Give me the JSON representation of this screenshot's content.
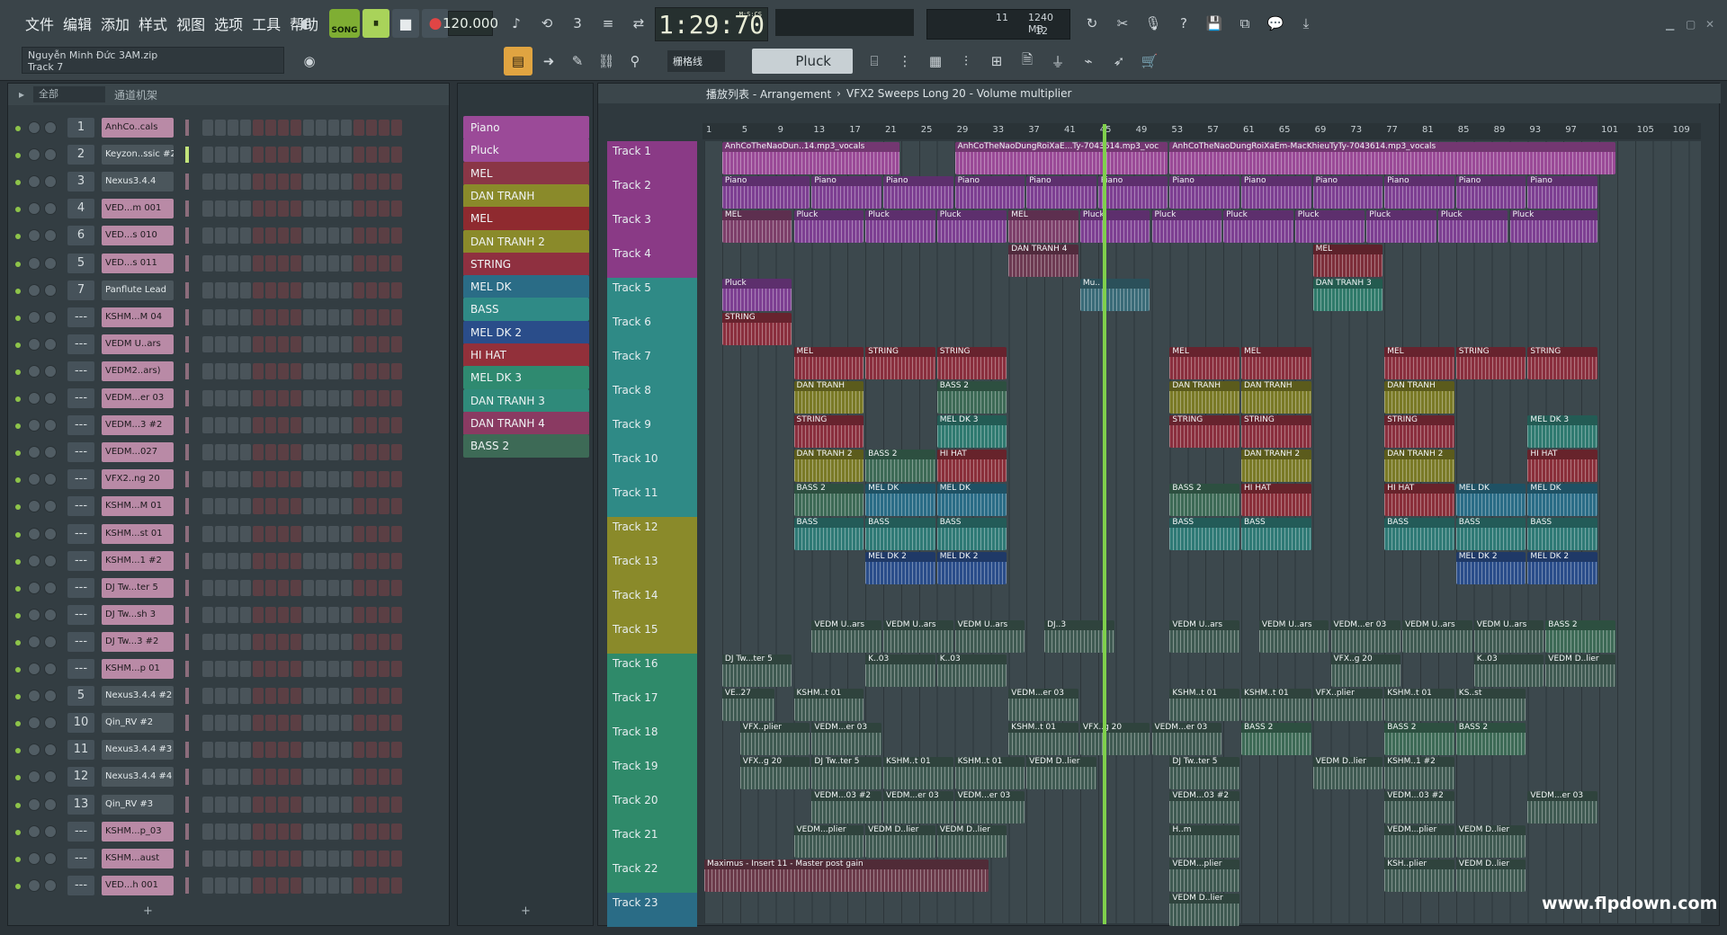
{
  "menu": [
    "文件",
    "编辑",
    "添加",
    "样式",
    "视图",
    "选项",
    "工具",
    "帮助"
  ],
  "transport": {
    "song_label": "SONG",
    "play": "⏸",
    "stop": "■",
    "record": "●",
    "tempo": "120.000",
    "time": "1:29:70",
    "time_unit": "M:S:CS"
  },
  "cpu": {
    "v1": "11",
    "v2": "1240 MB",
    "v3": "12"
  },
  "project": {
    "file": "Nguyễn Minh Đức 3AM.zip",
    "track": "Track 7"
  },
  "toolbar": {
    "snap": "栅格线",
    "pattern": "Pluck"
  },
  "rack": {
    "title": "通道机架",
    "filter": "全部"
  },
  "channels": [
    {
      "num": "1",
      "name": "AnhCo..cals",
      "sel": true
    },
    {
      "num": "2",
      "name": "Keyzon..ssic #2",
      "sel": false
    },
    {
      "num": "3",
      "name": "Nexus3.4.4",
      "sel": false
    },
    {
      "num": "4",
      "name": "VED...m 001",
      "sel": true
    },
    {
      "num": "6",
      "name": "VED...s 010",
      "sel": true
    },
    {
      "num": "5",
      "name": "VED...s 011",
      "sel": true
    },
    {
      "num": "7",
      "name": "Panflute Lead",
      "sel": false
    },
    {
      "num": "---",
      "name": "KSHM...M 04",
      "sel": true
    },
    {
      "num": "---",
      "name": "VEDM U..ars",
      "sel": true
    },
    {
      "num": "---",
      "name": "VEDM2..ars)",
      "sel": true
    },
    {
      "num": "---",
      "name": "VEDM...er 03",
      "sel": true
    },
    {
      "num": "---",
      "name": "VEDM...3 #2",
      "sel": true
    },
    {
      "num": "---",
      "name": "VEDM...027",
      "sel": true
    },
    {
      "num": "---",
      "name": "VFX2..ng 20",
      "sel": true
    },
    {
      "num": "---",
      "name": "KSHM...M 01",
      "sel": true
    },
    {
      "num": "---",
      "name": "KSHM...st 01",
      "sel": true
    },
    {
      "num": "---",
      "name": "KSHM...1 #2",
      "sel": true
    },
    {
      "num": "---",
      "name": "DJ Tw...ter 5",
      "sel": true
    },
    {
      "num": "---",
      "name": "DJ Tw...sh 3",
      "sel": true
    },
    {
      "num": "---",
      "name": "DJ Tw...3 #2",
      "sel": true
    },
    {
      "num": "---",
      "name": "KSHM...p 01",
      "sel": true
    },
    {
      "num": "5",
      "name": "Nexus3.4.4 #2",
      "sel": false
    },
    {
      "num": "10",
      "name": "Qin_RV #2",
      "sel": false
    },
    {
      "num": "11",
      "name": "Nexus3.4.4 #3",
      "sel": false
    },
    {
      "num": "12",
      "name": "Nexus3.4.4 #4",
      "sel": false
    },
    {
      "num": "13",
      "name": "Qin_RV #3",
      "sel": false
    },
    {
      "num": "---",
      "name": "KSHM...p_03",
      "sel": true
    },
    {
      "num": "---",
      "name": "KSHM...aust",
      "sel": true
    },
    {
      "num": "---",
      "name": "VED...h 001",
      "sel": true
    }
  ],
  "patterns": [
    {
      "name": "Piano",
      "color": "#9b4a98"
    },
    {
      "name": "Pluck",
      "color": "#9b4a98"
    },
    {
      "name": "MEL",
      "color": "#8a3646"
    },
    {
      "name": "DAN TRANH",
      "color": "#8a8a2a"
    },
    {
      "name": "MEL",
      "color": "#8f2a2f"
    },
    {
      "name": "DAN TRANH 2",
      "color": "#8a8a2a"
    },
    {
      "name": "STRING",
      "color": "#8f3040"
    },
    {
      "name": "MEL DK",
      "color": "#2a6c86"
    },
    {
      "name": "BASS",
      "color": "#2f8a86"
    },
    {
      "name": "MEL DK 2",
      "color": "#2a4d8a"
    },
    {
      "name": "HI HAT",
      "color": "#92303a"
    },
    {
      "name": "MEL DK 3",
      "color": "#2f8a70"
    },
    {
      "name": "DAN TRANH 3",
      "color": "#2f8a7a"
    },
    {
      "name": "DAN TRANH 4",
      "color": "#8a3a62"
    },
    {
      "name": "BASS 2",
      "color": "#3d6a56"
    }
  ],
  "playlist": {
    "title": "播放列表 - Arrangement",
    "arrow": "›",
    "pattern": "VFX2 Sweeps Long 20 - Volume multiplier"
  },
  "ruler": [
    "1",
    "5",
    "9",
    "13",
    "17",
    "21",
    "25",
    "29",
    "33",
    "37",
    "41",
    "45",
    "49",
    "53",
    "57",
    "61",
    "65",
    "69",
    "73",
    "77",
    "81",
    "85",
    "89",
    "93",
    "97",
    "101",
    "105",
    "109"
  ],
  "tracks": [
    "Track 1",
    "Track 2",
    "Track 3",
    "Track 4",
    "Track 5",
    "Track 6",
    "Track 7",
    "Track 8",
    "Track 9",
    "Track 10",
    "Track 11",
    "Track 12",
    "Track 13",
    "Track 14",
    "Track 15",
    "Track 16",
    "Track 17",
    "Track 18",
    "Track 19",
    "Track 20",
    "Track 21",
    "Track 22",
    "Track 23"
  ],
  "track_colors": [
    "#8a3a86",
    "#8a3a86",
    "#8a3a86",
    "#8a3a86",
    "#2f8a86",
    "#2f8a86",
    "#2f8a86",
    "#2f8a86",
    "#2f8a86",
    "#2f8a86",
    "#2f8a86",
    "#8a8a2a",
    "#8a8a2a",
    "#8a8a2a",
    "#8a8a2a",
    "#2f8a6a",
    "#2f8a6a",
    "#2f8a6a",
    "#2f8a6a",
    "#2f8a6a",
    "#2f8a6a",
    "#2f8a6a",
    "#2a6c86"
  ],
  "clips": [
    {
      "t": 0,
      "s": 1,
      "e": 11,
      "label": "AnhCoTheNaoDun..14.mp3_vocals",
      "color": "#9a4a97"
    },
    {
      "t": 0,
      "s": 14,
      "e": 26,
      "label": "AnhCoTheNaoDungRoiXaE...Ty-7043614.mp3_voc",
      "color": "#9a4a97"
    },
    {
      "t": 0,
      "s": 26,
      "e": 51,
      "label": "AnhCoTheNaoDungRoiXaEm-MacKhieuTyTy-7043614.mp3_vocals",
      "color": "#9a4a97"
    },
    {
      "t": 1,
      "s": 1,
      "e": 6,
      "label": "Piano",
      "color": "#7d3f92"
    },
    {
      "t": 1,
      "s": 6,
      "e": 10,
      "label": "Piano",
      "color": "#7d3f92"
    },
    {
      "t": 1,
      "s": 10,
      "e": 14,
      "label": "Piano",
      "color": "#7d3f92"
    },
    {
      "t": 1,
      "s": 14,
      "e": 18,
      "label": "Piano",
      "color": "#7d3f92"
    },
    {
      "t": 1,
      "s": 18,
      "e": 22,
      "label": "Piano",
      "color": "#7d3f92"
    },
    {
      "t": 1,
      "s": 22,
      "e": 26,
      "label": "Piano",
      "color": "#7d3f92"
    },
    {
      "t": 1,
      "s": 26,
      "e": 30,
      "label": "Piano",
      "color": "#7d3f92"
    },
    {
      "t": 1,
      "s": 30,
      "e": 34,
      "label": "Piano",
      "color": "#7d3f92"
    },
    {
      "t": 1,
      "s": 34,
      "e": 38,
      "label": "Piano",
      "color": "#7d3f92"
    },
    {
      "t": 1,
      "s": 38,
      "e": 42,
      "label": "Piano",
      "color": "#7d3f92"
    },
    {
      "t": 1,
      "s": 42,
      "e": 46,
      "label": "Piano",
      "color": "#7d3f92"
    },
    {
      "t": 1,
      "s": 46,
      "e": 50,
      "label": "Piano",
      "color": "#7d3f92"
    },
    {
      "t": 2,
      "s": 1,
      "e": 5,
      "label": "MEL",
      "color": "#7d3f6a"
    },
    {
      "t": 2,
      "s": 5,
      "e": 9,
      "label": "Pluck",
      "color": "#7d3f92"
    },
    {
      "t": 2,
      "s": 9,
      "e": 13,
      "label": "Pluck",
      "color": "#7d3f92"
    },
    {
      "t": 2,
      "s": 13,
      "e": 17,
      "label": "Pluck",
      "color": "#7d3f92"
    },
    {
      "t": 2,
      "s": 17,
      "e": 21,
      "label": "MEL",
      "color": "#7d3f6a"
    },
    {
      "t": 2,
      "s": 21,
      "e": 25,
      "label": "Pluck",
      "color": "#7d3f92"
    },
    {
      "t": 2,
      "s": 25,
      "e": 29,
      "label": "Pluck",
      "color": "#7d3f92"
    },
    {
      "t": 2,
      "s": 29,
      "e": 33,
      "label": "Pluck",
      "color": "#7d3f92"
    },
    {
      "t": 2,
      "s": 33,
      "e": 37,
      "label": "Pluck",
      "color": "#7d3f92"
    },
    {
      "t": 2,
      "s": 37,
      "e": 41,
      "label": "Pluck",
      "color": "#7d3f92"
    },
    {
      "t": 2,
      "s": 41,
      "e": 45,
      "label": "Pluck",
      "color": "#7d3f92"
    },
    {
      "t": 2,
      "s": 45,
      "e": 50,
      "label": "Pluck",
      "color": "#7d3f92"
    },
    {
      "t": 3,
      "s": 17,
      "e": 21,
      "label": "DAN TRANH 4",
      "color": "#6d3a52"
    },
    {
      "t": 3,
      "s": 34,
      "e": 38,
      "label": "MEL",
      "color": "#7d2e3a"
    },
    {
      "t": 4,
      "s": 1,
      "e": 5,
      "label": "Pluck",
      "color": "#7d3f92"
    },
    {
      "t": 4,
      "s": 21,
      "e": 25,
      "label": "Mu..",
      "color": "#3a6b78"
    },
    {
      "t": 4,
      "s": 34,
      "e": 38,
      "label": "DAN TRANH 3",
      "color": "#2f7a6a"
    },
    {
      "t": 5,
      "s": 1,
      "e": 5,
      "label": "STRING",
      "color": "#8a2f3e"
    },
    {
      "t": 6,
      "s": 5,
      "e": 9,
      "label": "MEL",
      "color": "#8a2f3e"
    },
    {
      "t": 6,
      "s": 9,
      "e": 13,
      "label": "STRING",
      "color": "#8a2f3e"
    },
    {
      "t": 6,
      "s": 13,
      "e": 17,
      "label": "STRING",
      "color": "#8a2f3e"
    },
    {
      "t": 6,
      "s": 26,
      "e": 30,
      "label": "MEL",
      "color": "#8a2f3e"
    },
    {
      "t": 6,
      "s": 30,
      "e": 34,
      "label": "MEL",
      "color": "#8a2f3e"
    },
    {
      "t": 6,
      "s": 38,
      "e": 42,
      "label": "MEL",
      "color": "#8a2f3e"
    },
    {
      "t": 6,
      "s": 42,
      "e": 46,
      "label": "STRING",
      "color": "#8a2f3e"
    },
    {
      "t": 6,
      "s": 46,
      "e": 50,
      "label": "STRING",
      "color": "#8a2f3e"
    },
    {
      "t": 7,
      "s": 5,
      "e": 9,
      "label": "DAN TRANH",
      "color": "#7a7a26"
    },
    {
      "t": 7,
      "s": 13,
      "e": 17,
      "label": "BASS 2",
      "color": "#3d6a56"
    },
    {
      "t": 7,
      "s": 26,
      "e": 30,
      "label": "DAN TRANH",
      "color": "#7a7a26"
    },
    {
      "t": 7,
      "s": 30,
      "e": 34,
      "label": "DAN TRANH",
      "color": "#7a7a26"
    },
    {
      "t": 7,
      "s": 38,
      "e": 42,
      "label": "DAN TRANH",
      "color": "#7a7a26"
    },
    {
      "t": 8,
      "s": 5,
      "e": 9,
      "label": "STRING",
      "color": "#8a2f3e"
    },
    {
      "t": 8,
      "s": 13,
      "e": 17,
      "label": "MEL DK 3",
      "color": "#2f7a70"
    },
    {
      "t": 8,
      "s": 26,
      "e": 30,
      "label": "STRING",
      "color": "#8a2f3e"
    },
    {
      "t": 8,
      "s": 30,
      "e": 34,
      "label": "STRING",
      "color": "#8a2f3e"
    },
    {
      "t": 8,
      "s": 38,
      "e": 42,
      "label": "STRING",
      "color": "#8a2f3e"
    },
    {
      "t": 8,
      "s": 46,
      "e": 50,
      "label": "MEL DK 3",
      "color": "#2f7a70"
    },
    {
      "t": 9,
      "s": 5,
      "e": 9,
      "label": "DAN TRANH 2",
      "color": "#7a7a26"
    },
    {
      "t": 9,
      "s": 9,
      "e": 13,
      "label": "BASS 2",
      "color": "#3d6a56"
    },
    {
      "t": 9,
      "s": 13,
      "e": 17,
      "label": "HI HAT",
      "color": "#8a2f3a"
    },
    {
      "t": 9,
      "s": 30,
      "e": 34,
      "label": "DAN TRANH 2",
      "color": "#7a7a26"
    },
    {
      "t": 9,
      "s": 38,
      "e": 42,
      "label": "DAN TRANH 2",
      "color": "#7a7a26"
    },
    {
      "t": 9,
      "s": 46,
      "e": 50,
      "label": "HI HAT",
      "color": "#8a2f3a"
    },
    {
      "t": 10,
      "s": 5,
      "e": 9,
      "label": "BASS 2",
      "color": "#3d6a56"
    },
    {
      "t": 10,
      "s": 9,
      "e": 13,
      "label": "MEL DK",
      "color": "#2a6c86"
    },
    {
      "t": 10,
      "s": 13,
      "e": 17,
      "label": "MEL DK",
      "color": "#2a6c86"
    },
    {
      "t": 10,
      "s": 26,
      "e": 30,
      "label": "BASS 2",
      "color": "#3d6a56"
    },
    {
      "t": 10,
      "s": 30,
      "e": 34,
      "label": "HI HAT",
      "color": "#8a2f3a"
    },
    {
      "t": 10,
      "s": 38,
      "e": 42,
      "label": "HI HAT",
      "color": "#8a2f3a"
    },
    {
      "t": 10,
      "s": 42,
      "e": 46,
      "label": "MEL DK",
      "color": "#2a6c86"
    },
    {
      "t": 10,
      "s": 46,
      "e": 50,
      "label": "MEL DK",
      "color": "#2a6c86"
    },
    {
      "t": 11,
      "s": 5,
      "e": 9,
      "label": "BASS",
      "color": "#2f7a76"
    },
    {
      "t": 11,
      "s": 9,
      "e": 13,
      "label": "BASS",
      "color": "#2f7a76"
    },
    {
      "t": 11,
      "s": 13,
      "e": 17,
      "label": "BASS",
      "color": "#2f7a76"
    },
    {
      "t": 11,
      "s": 26,
      "e": 30,
      "label": "BASS",
      "color": "#2f7a76"
    },
    {
      "t": 11,
      "s": 30,
      "e": 34,
      "label": "BASS",
      "color": "#2f7a76"
    },
    {
      "t": 11,
      "s": 38,
      "e": 42,
      "label": "BASS",
      "color": "#2f7a76"
    },
    {
      "t": 11,
      "s": 42,
      "e": 46,
      "label": "BASS",
      "color": "#2f7a76"
    },
    {
      "t": 11,
      "s": 46,
      "e": 50,
      "label": "BASS",
      "color": "#2f7a76"
    },
    {
      "t": 12,
      "s": 9,
      "e": 13,
      "label": "MEL DK 2",
      "color": "#2a4d8a"
    },
    {
      "t": 12,
      "s": 13,
      "e": 17,
      "label": "MEL DK 2",
      "color": "#2a4d8a"
    },
    {
      "t": 12,
      "s": 42,
      "e": 46,
      "label": "MEL DK 2",
      "color": "#2a4d8a"
    },
    {
      "t": 12,
      "s": 46,
      "e": 50,
      "label": "MEL DK 2",
      "color": "#2a4d8a"
    },
    {
      "t": 14,
      "s": 6,
      "e": 10,
      "label": "VEDM U..ars",
      "color": "#3f5a52"
    },
    {
      "t": 14,
      "s": 10,
      "e": 14,
      "label": "VEDM U..ars",
      "color": "#3f5a52"
    },
    {
      "t": 14,
      "s": 14,
      "e": 18,
      "label": "VEDM U..ars",
      "color": "#3f5a52"
    },
    {
      "t": 14,
      "s": 19,
      "e": 23,
      "label": "DJ..3",
      "color": "#3f5a52"
    },
    {
      "t": 14,
      "s": 26,
      "e": 30,
      "label": "VEDM U..ars",
      "color": "#3f5a52"
    },
    {
      "t": 14,
      "s": 31,
      "e": 35,
      "label": "VEDM U..ars",
      "color": "#3f5a52"
    },
    {
      "t": 14,
      "s": 35,
      "e": 39,
      "label": "VEDM...er 03",
      "color": "#3f5a52"
    },
    {
      "t": 14,
      "s": 39,
      "e": 43,
      "label": "VEDM U..ars",
      "color": "#3f5a52"
    },
    {
      "t": 14,
      "s": 43,
      "e": 47,
      "label": "VEDM U..ars",
      "color": "#3f5a52"
    },
    {
      "t": 14,
      "s": 47,
      "e": 51,
      "label": "BASS 2",
      "color": "#3d6a56"
    },
    {
      "t": 15,
      "s": 1,
      "e": 5,
      "label": "DJ Tw...ter 5",
      "color": "#3f5a52"
    },
    {
      "t": 15,
      "s": 9,
      "e": 13,
      "label": "K..03",
      "color": "#3f5a52"
    },
    {
      "t": 15,
      "s": 13,
      "e": 17,
      "label": "K..03",
      "color": "#3f5a52"
    },
    {
      "t": 15,
      "s": 35,
      "e": 39,
      "label": "VFX..g 20",
      "color": "#3f5a52"
    },
    {
      "t": 15,
      "s": 43,
      "e": 47,
      "label": "K..03",
      "color": "#3f5a52"
    },
    {
      "t": 15,
      "s": 47,
      "e": 51,
      "label": "VEDM D..lier",
      "color": "#3f5a52"
    },
    {
      "t": 16,
      "s": 1,
      "e": 4,
      "label": "VE..27",
      "color": "#3f5a52"
    },
    {
      "t": 16,
      "s": 5,
      "e": 9,
      "label": "KSHM..t 01",
      "color": "#3f5a52"
    },
    {
      "t": 16,
      "s": 17,
      "e": 21,
      "label": "VEDM...er 03",
      "color": "#3f5a52"
    },
    {
      "t": 16,
      "s": 26,
      "e": 30,
      "label": "KSHM..t 01",
      "color": "#3f5a52"
    },
    {
      "t": 16,
      "s": 30,
      "e": 34,
      "label": "KSHM..t 01",
      "color": "#3f5a52"
    },
    {
      "t": 16,
      "s": 34,
      "e": 38,
      "label": "VFX..plier",
      "color": "#3f5a52"
    },
    {
      "t": 16,
      "s": 38,
      "e": 42,
      "label": "KSHM..t 01",
      "color": "#3f5a52"
    },
    {
      "t": 16,
      "s": 42,
      "e": 46,
      "label": "KS..st",
      "color": "#3f5a52"
    },
    {
      "t": 17,
      "s": 2,
      "e": 6,
      "label": "VFX..plier",
      "color": "#3f5a52"
    },
    {
      "t": 17,
      "s": 6,
      "e": 10,
      "label": "VEDM...er 03",
      "color": "#3f5a52"
    },
    {
      "t": 17,
      "s": 17,
      "e": 21,
      "label": "KSHM..t 01",
      "color": "#3f5a52"
    },
    {
      "t": 17,
      "s": 21,
      "e": 25,
      "label": "VFX..g 20",
      "color": "#3f5a52"
    },
    {
      "t": 17,
      "s": 25,
      "e": 29,
      "label": "VEDM...er 03",
      "color": "#3f5a52"
    },
    {
      "t": 17,
      "s": 30,
      "e": 34,
      "label": "BASS 2",
      "color": "#3d6a56"
    },
    {
      "t": 17,
      "s": 38,
      "e": 42,
      "label": "BASS 2",
      "color": "#3d6a56"
    },
    {
      "t": 17,
      "s": 42,
      "e": 46,
      "label": "BASS 2",
      "color": "#3d6a56"
    },
    {
      "t": 18,
      "s": 2,
      "e": 6,
      "label": "VFX..g 20",
      "color": "#3f5a52"
    },
    {
      "t": 18,
      "s": 6,
      "e": 10,
      "label": "DJ Tw..ter 5",
      "color": "#3f5a52"
    },
    {
      "t": 18,
      "s": 10,
      "e": 14,
      "label": "KSHM..t 01",
      "color": "#3f5a52"
    },
    {
      "t": 18,
      "s": 14,
      "e": 18,
      "label": "KSHM..t 01",
      "color": "#3f5a52"
    },
    {
      "t": 18,
      "s": 18,
      "e": 22,
      "label": "VEDM D..lier",
      "color": "#3f5a52"
    },
    {
      "t": 18,
      "s": 26,
      "e": 30,
      "label": "DJ Tw..ter 5",
      "color": "#3f5a52"
    },
    {
      "t": 18,
      "s": 34,
      "e": 38,
      "label": "VEDM D..lier",
      "color": "#3f5a52"
    },
    {
      "t": 18,
      "s": 38,
      "e": 42,
      "label": "KSHM..1 #2",
      "color": "#3f5a52"
    },
    {
      "t": 19,
      "s": 6,
      "e": 10,
      "label": "VEDM...03 #2",
      "color": "#3f5a52"
    },
    {
      "t": 19,
      "s": 10,
      "e": 14,
      "label": "VEDM...er 03",
      "color": "#3f5a52"
    },
    {
      "t": 19,
      "s": 14,
      "e": 18,
      "label": "VEDM...er 03",
      "color": "#3f5a52"
    },
    {
      "t": 19,
      "s": 26,
      "e": 30,
      "label": "VEDM...03 #2",
      "color": "#3f5a52"
    },
    {
      "t": 19,
      "s": 38,
      "e": 42,
      "label": "VEDM...03 #2",
      "color": "#3f5a52"
    },
    {
      "t": 19,
      "s": 46,
      "e": 50,
      "label": "VEDM...er 03",
      "color": "#3f5a52"
    },
    {
      "t": 20,
      "s": 5,
      "e": 9,
      "label": "VEDM...plier",
      "color": "#3f5a52"
    },
    {
      "t": 20,
      "s": 9,
      "e": 13,
      "label": "VEDM D..lier",
      "color": "#3f5a52"
    },
    {
      "t": 20,
      "s": 13,
      "e": 17,
      "label": "VEDM D..lier",
      "color": "#3f5a52"
    },
    {
      "t": 20,
      "s": 26,
      "e": 30,
      "label": "H..m",
      "color": "#3f5a52"
    },
    {
      "t": 20,
      "s": 38,
      "e": 42,
      "label": "VEDM...plier",
      "color": "#3f5a52"
    },
    {
      "t": 20,
      "s": 42,
      "e": 46,
      "label": "VEDM D..lier",
      "color": "#3f5a52"
    },
    {
      "t": 21,
      "s": 0,
      "e": 16,
      "label": "Maximus - Insert 11 - Master post gain",
      "color": "#6b3a4a"
    },
    {
      "t": 21,
      "s": 26,
      "e": 30,
      "label": "VEDM...plier",
      "color": "#3f5a52"
    },
    {
      "t": 21,
      "s": 38,
      "e": 42,
      "label": "KSH..plier",
      "color": "#3f5a52"
    },
    {
      "t": 21,
      "s": 42,
      "e": 46,
      "label": "VEDM D..lier",
      "color": "#3f5a52"
    },
    {
      "t": 22,
      "s": 26,
      "e": 30,
      "label": "VEDM D..lier",
      "color": "#3f5a52"
    }
  ],
  "watermark": "www.flpdown.com"
}
